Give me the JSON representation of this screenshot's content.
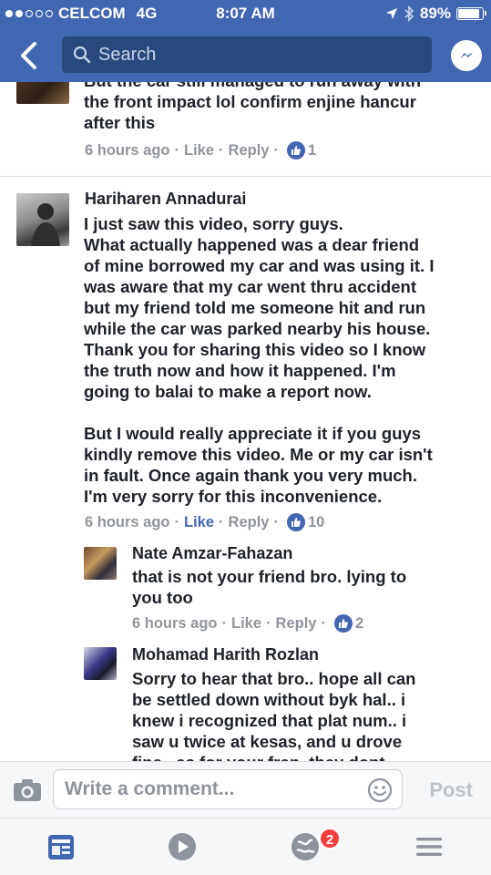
{
  "status_bar": {
    "carrier": "CELCOM",
    "network": "4G",
    "time": "8:07 AM",
    "battery": "89%",
    "battery_level": 0.89,
    "signal_bars_filled": 2,
    "signal_bars_total": 5
  },
  "header": {
    "search_placeholder": "Search",
    "back_icon": "chevron-left-icon",
    "messenger_icon": "messenger-icon"
  },
  "comments": [
    {
      "author": "",
      "lines": [
        "But the car still managed to run away with",
        "the front impact lol confirm enjine hancur",
        "after this"
      ],
      "time": "6 hours ago",
      "like_label": "Like",
      "reply_label": "Reply",
      "like_count": "1",
      "liked": false
    },
    {
      "author": "Hariharen Annadurai",
      "lines": [
        "I just saw this video, sorry guys.",
        "What actually happened was a dear friend",
        "of mine borrowed my car and was using it. I",
        "was aware that my car went thru accident",
        "but my friend told me someone hit and run",
        "while the car was parked nearby his house.",
        "Thank you for sharing this video so I know",
        "the truth now and how it happened. I'm",
        "going to balai to make a report now.",
        "",
        "But I would really appreciate it if you guys",
        "kindly remove this video. Me or my car isn't",
        "in fault. Once again thank you very much.",
        "I'm very sorry for this inconvenience."
      ],
      "time": "6 hours ago",
      "like_label": "Like",
      "reply_label": "Reply",
      "like_count": "10",
      "liked": true
    }
  ],
  "replies": [
    {
      "author": "Nate Amzar-Fahazan",
      "lines": [
        "that is not your friend bro. lying to",
        "you too"
      ],
      "time": "6 hours ago",
      "like_label": "Like",
      "reply_label": "Reply",
      "like_count": "2",
      "liked": false
    },
    {
      "author": "Mohamad Harith Rozlan",
      "lines": [
        "Sorry to hear that bro.. hope all can",
        "be settled down without byk hal.. i",
        "knew i recognized that plat num.. i",
        "saw u twice at kesas, and u drove",
        "fine.. as for your fren, they dont"
      ]
    }
  ],
  "composer": {
    "placeholder": "Write a comment...",
    "post_label": "Post",
    "camera_icon": "camera-icon",
    "emoji_icon": "smiley-icon"
  },
  "tabbar": {
    "tabs": [
      "news-feed-icon",
      "video-icon",
      "notifications-globe-icon",
      "menu-icon"
    ],
    "notification_badge": "2"
  },
  "colors": {
    "brand_blue": "#4267b2",
    "search_bg": "#29487d",
    "meta_gray": "#90949c",
    "badge_red": "#fa3e3e"
  }
}
